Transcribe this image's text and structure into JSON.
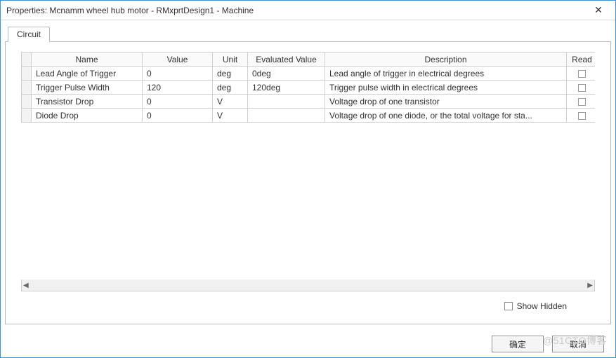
{
  "window": {
    "title": "Properties: Mcnamm wheel hub motor - RMxprtDesign1 - Machine",
    "close_glyph": "✕"
  },
  "tabs": [
    {
      "label": "Circuit"
    }
  ],
  "grid": {
    "columns": {
      "name": "Name",
      "value": "Value",
      "unit": "Unit",
      "evaluated": "Evaluated Value",
      "description": "Description",
      "read": "Read"
    },
    "rows": [
      {
        "name": "Lead Angle of Trigger",
        "value": "0",
        "unit": "deg",
        "evaluated": "0deg",
        "description": "Lead angle of trigger in electrical degrees"
      },
      {
        "name": "Trigger Pulse Width",
        "value": "120",
        "unit": "deg",
        "evaluated": "120deg",
        "description": "Trigger pulse width in electrical degrees"
      },
      {
        "name": "Transistor Drop",
        "value": "0",
        "unit": "V",
        "evaluated": "",
        "description": "Voltage drop of one transistor"
      },
      {
        "name": "Diode Drop",
        "value": "0",
        "unit": "V",
        "evaluated": "",
        "description": "Voltage drop of one diode, or the total voltage for sta..."
      }
    ]
  },
  "footer": {
    "show_hidden_label": "Show Hidden",
    "ok_label": "确定",
    "cancel_label": "取消"
  },
  "watermark": "@51CTO博客"
}
